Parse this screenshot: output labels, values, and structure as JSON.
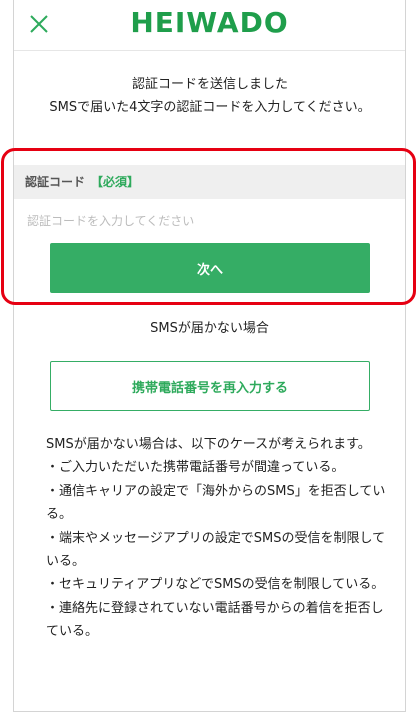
{
  "header": {
    "close_icon": "close-icon",
    "logo_text": "HEIWADO",
    "brand_color": "#1f9e4b"
  },
  "intro": {
    "line1": "認証コードを送信しました",
    "line2": "SMSで届いた4文字の認証コードを入力してください。"
  },
  "form": {
    "label": "認証コード",
    "required": "【必須】",
    "placeholder": "認証コードを入力してください",
    "value": "",
    "next_label": "次へ"
  },
  "sms_help": {
    "title": "SMSが届かない場合",
    "reenter_label": "携帯電話番号を再入力する",
    "intro": "SMSが届かない場合は、以下のケースが考えられます。",
    "cases": [
      "・ご入力いただいた携帯電話番号が間違っている。",
      "・通信キャリアの設定で「海外からのSMS」を拒否している。",
      "・端末やメッセージアプリの設定でSMSの受信を制限している。",
      "・セキュリティアプリなどでSMSの受信を制限している。",
      "・連絡先に登録されていない電話番号からの着信を拒否している。"
    ]
  },
  "colors": {
    "accent_green": "#35ad65",
    "highlight_red": "#e60012"
  }
}
